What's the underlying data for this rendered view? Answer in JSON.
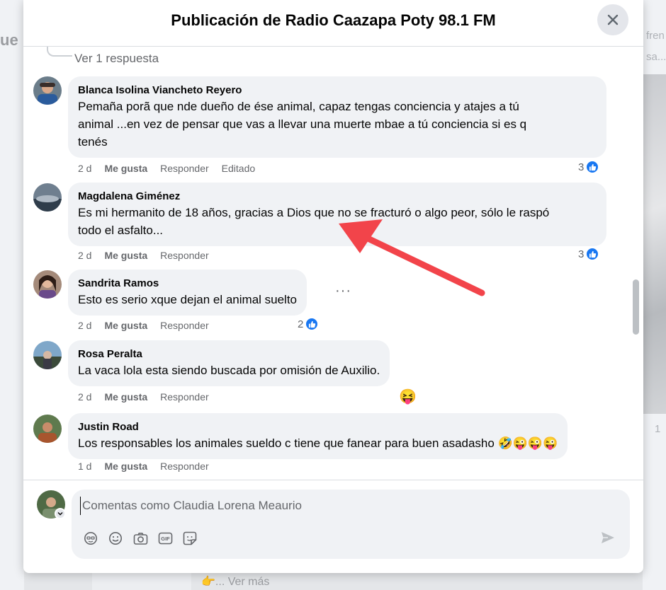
{
  "background": {
    "left_fragment": "ue",
    "right_fragment_1": "fren",
    "right_fragment_2": "sa...",
    "right_fragment_3": "1",
    "see_more": "Ver más"
  },
  "modal": {
    "title": "Publicación de Radio Caazapa Poty 98.1 FM",
    "see_reply": "Ver 1 respuesta"
  },
  "comments": [
    {
      "author": "Blanca Isolina Viancheto Reyero",
      "lines": [
        "Pemaña porã que nde dueño de ése animal, capaz tengas conciencia y atajes a tú",
        "animal ...en vez de pensar que vas a llevar una muerte mbae a tú conciencia si es q",
        "tenés"
      ],
      "time": "2 d",
      "like": "Me gusta",
      "reply": "Responder",
      "edited": "Editado",
      "reactions": "3"
    },
    {
      "author": "Magdalena Giménez",
      "lines": [
        "Es mi hermanito de 18 años, gracias a Dios que no se fracturó o algo peor, sólo le raspó",
        "todo el asfalto..."
      ],
      "time": "2 d",
      "like": "Me gusta",
      "reply": "Responder",
      "reactions": "3"
    },
    {
      "author": "Sandrita Ramos",
      "lines": [
        "Esto es serio xque dejan el animal suelto"
      ],
      "time": "2 d",
      "like": "Me gusta",
      "reply": "Responder",
      "reactions": "2"
    },
    {
      "author": "Rosa Peralta",
      "lines": [
        "La vaca lola esta siendo buscada por omisión de Auxilio."
      ],
      "time": "2 d",
      "like": "Me gusta",
      "reply": "Responder",
      "reaction_emoji": "😝"
    },
    {
      "author": "Justin Road",
      "lines": [
        "Los responsables los animales sueldo c tiene que fanear para buen asadasho 🤣😜😜😜"
      ],
      "time": "1 d",
      "like": "Me gusta",
      "reply": "Responder"
    }
  ],
  "composer": {
    "placeholder": "Comentas como Claudia Lorena Meaurio"
  },
  "colors": {
    "accent": "#1877f2",
    "arrow": "#f2444a",
    "bubble": "#f0f2f5",
    "meta_text": "#65676b"
  },
  "icons": [
    "close-icon",
    "like-icon",
    "avatar-sticker-icon",
    "emoji-icon",
    "camera-icon",
    "gif-icon",
    "sticker-icon",
    "send-icon",
    "chevron-down-icon"
  ]
}
